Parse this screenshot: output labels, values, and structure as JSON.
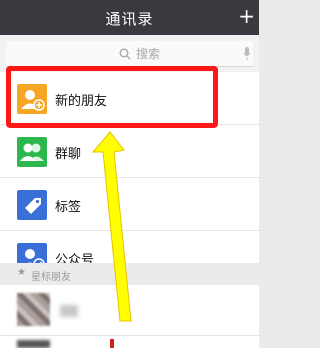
{
  "header": {
    "title": "通讯录",
    "add_icon": "plus-icon"
  },
  "search": {
    "placeholder": "搜索",
    "search_icon": "search-icon",
    "voice_icon": "microphone-icon"
  },
  "entries": [
    {
      "label": "新的朋友",
      "icon": "add-friend-icon",
      "color": "#f5a623"
    },
    {
      "label": "群聊",
      "icon": "group-chat-icon",
      "color": "#2db84d"
    },
    {
      "label": "标签",
      "icon": "tag-icon",
      "color": "#3b6fd8"
    },
    {
      "label": "公众号",
      "icon": "official-account-icon",
      "color": "#3b6fd8"
    }
  ],
  "starred": {
    "heading": "星标朋友"
  },
  "annotation": {
    "highlight_color": "#ff1616",
    "arrow_color": "#ffff00"
  }
}
